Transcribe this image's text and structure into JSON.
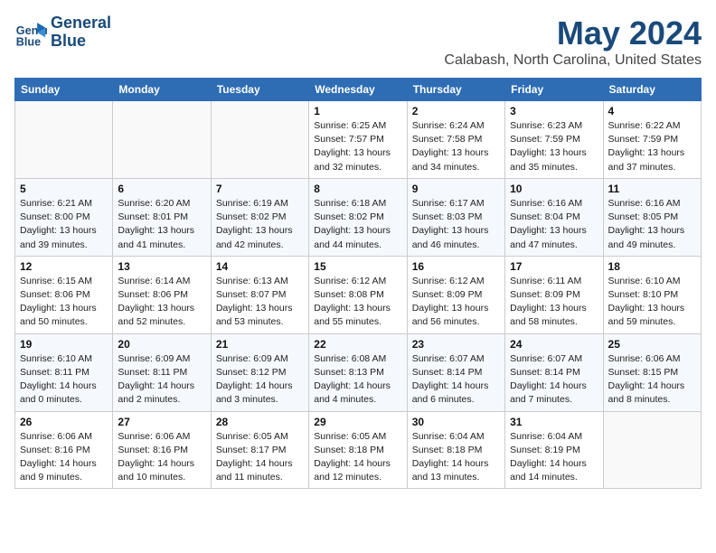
{
  "header": {
    "logo_line1": "General",
    "logo_line2": "Blue",
    "month": "May 2024",
    "location": "Calabash, North Carolina, United States"
  },
  "weekdays": [
    "Sunday",
    "Monday",
    "Tuesday",
    "Wednesday",
    "Thursday",
    "Friday",
    "Saturday"
  ],
  "weeks": [
    [
      {
        "day": "",
        "info": ""
      },
      {
        "day": "",
        "info": ""
      },
      {
        "day": "",
        "info": ""
      },
      {
        "day": "1",
        "info": "Sunrise: 6:25 AM\nSunset: 7:57 PM\nDaylight: 13 hours\nand 32 minutes."
      },
      {
        "day": "2",
        "info": "Sunrise: 6:24 AM\nSunset: 7:58 PM\nDaylight: 13 hours\nand 34 minutes."
      },
      {
        "day": "3",
        "info": "Sunrise: 6:23 AM\nSunset: 7:59 PM\nDaylight: 13 hours\nand 35 minutes."
      },
      {
        "day": "4",
        "info": "Sunrise: 6:22 AM\nSunset: 7:59 PM\nDaylight: 13 hours\nand 37 minutes."
      }
    ],
    [
      {
        "day": "5",
        "info": "Sunrise: 6:21 AM\nSunset: 8:00 PM\nDaylight: 13 hours\nand 39 minutes."
      },
      {
        "day": "6",
        "info": "Sunrise: 6:20 AM\nSunset: 8:01 PM\nDaylight: 13 hours\nand 41 minutes."
      },
      {
        "day": "7",
        "info": "Sunrise: 6:19 AM\nSunset: 8:02 PM\nDaylight: 13 hours\nand 42 minutes."
      },
      {
        "day": "8",
        "info": "Sunrise: 6:18 AM\nSunset: 8:02 PM\nDaylight: 13 hours\nand 44 minutes."
      },
      {
        "day": "9",
        "info": "Sunrise: 6:17 AM\nSunset: 8:03 PM\nDaylight: 13 hours\nand 46 minutes."
      },
      {
        "day": "10",
        "info": "Sunrise: 6:16 AM\nSunset: 8:04 PM\nDaylight: 13 hours\nand 47 minutes."
      },
      {
        "day": "11",
        "info": "Sunrise: 6:16 AM\nSunset: 8:05 PM\nDaylight: 13 hours\nand 49 minutes."
      }
    ],
    [
      {
        "day": "12",
        "info": "Sunrise: 6:15 AM\nSunset: 8:06 PM\nDaylight: 13 hours\nand 50 minutes."
      },
      {
        "day": "13",
        "info": "Sunrise: 6:14 AM\nSunset: 8:06 PM\nDaylight: 13 hours\nand 52 minutes."
      },
      {
        "day": "14",
        "info": "Sunrise: 6:13 AM\nSunset: 8:07 PM\nDaylight: 13 hours\nand 53 minutes."
      },
      {
        "day": "15",
        "info": "Sunrise: 6:12 AM\nSunset: 8:08 PM\nDaylight: 13 hours\nand 55 minutes."
      },
      {
        "day": "16",
        "info": "Sunrise: 6:12 AM\nSunset: 8:09 PM\nDaylight: 13 hours\nand 56 minutes."
      },
      {
        "day": "17",
        "info": "Sunrise: 6:11 AM\nSunset: 8:09 PM\nDaylight: 13 hours\nand 58 minutes."
      },
      {
        "day": "18",
        "info": "Sunrise: 6:10 AM\nSunset: 8:10 PM\nDaylight: 13 hours\nand 59 minutes."
      }
    ],
    [
      {
        "day": "19",
        "info": "Sunrise: 6:10 AM\nSunset: 8:11 PM\nDaylight: 14 hours\nand 0 minutes."
      },
      {
        "day": "20",
        "info": "Sunrise: 6:09 AM\nSunset: 8:11 PM\nDaylight: 14 hours\nand 2 minutes."
      },
      {
        "day": "21",
        "info": "Sunrise: 6:09 AM\nSunset: 8:12 PM\nDaylight: 14 hours\nand 3 minutes."
      },
      {
        "day": "22",
        "info": "Sunrise: 6:08 AM\nSunset: 8:13 PM\nDaylight: 14 hours\nand 4 minutes."
      },
      {
        "day": "23",
        "info": "Sunrise: 6:07 AM\nSunset: 8:14 PM\nDaylight: 14 hours\nand 6 minutes."
      },
      {
        "day": "24",
        "info": "Sunrise: 6:07 AM\nSunset: 8:14 PM\nDaylight: 14 hours\nand 7 minutes."
      },
      {
        "day": "25",
        "info": "Sunrise: 6:06 AM\nSunset: 8:15 PM\nDaylight: 14 hours\nand 8 minutes."
      }
    ],
    [
      {
        "day": "26",
        "info": "Sunrise: 6:06 AM\nSunset: 8:16 PM\nDaylight: 14 hours\nand 9 minutes."
      },
      {
        "day": "27",
        "info": "Sunrise: 6:06 AM\nSunset: 8:16 PM\nDaylight: 14 hours\nand 10 minutes."
      },
      {
        "day": "28",
        "info": "Sunrise: 6:05 AM\nSunset: 8:17 PM\nDaylight: 14 hours\nand 11 minutes."
      },
      {
        "day": "29",
        "info": "Sunrise: 6:05 AM\nSunset: 8:18 PM\nDaylight: 14 hours\nand 12 minutes."
      },
      {
        "day": "30",
        "info": "Sunrise: 6:04 AM\nSunset: 8:18 PM\nDaylight: 14 hours\nand 13 minutes."
      },
      {
        "day": "31",
        "info": "Sunrise: 6:04 AM\nSunset: 8:19 PM\nDaylight: 14 hours\nand 14 minutes."
      },
      {
        "day": "",
        "info": ""
      }
    ]
  ]
}
